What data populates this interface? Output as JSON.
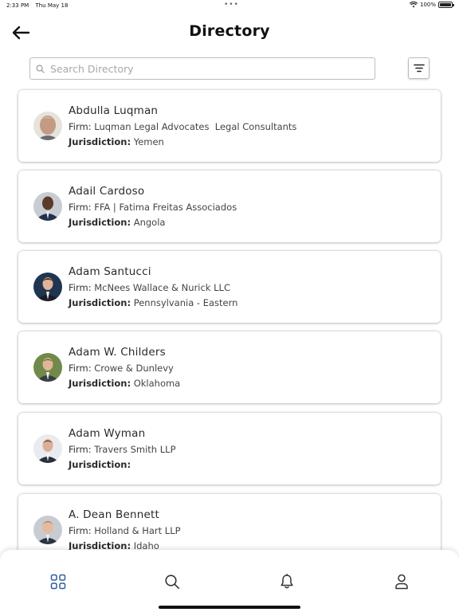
{
  "status_bar": {
    "time": "2:33 PM",
    "date": "Thu May 18",
    "battery": "100%"
  },
  "header": {
    "title": "Directory"
  },
  "search": {
    "placeholder": "Search Directory",
    "value": ""
  },
  "labels": {
    "firm": "Firm:",
    "jurisdiction": "Jurisdiction:"
  },
  "contacts": [
    {
      "name": "Abdulla Luqman",
      "firm": "Luqman Legal Advocates  Legal Consultants",
      "jurisdiction": "Yemen"
    },
    {
      "name": "Adail Cardoso",
      "firm": "FFA | Fatima Freitas Associados",
      "jurisdiction": "Angola"
    },
    {
      "name": "Adam Santucci",
      "firm": "McNees Wallace & Nurick LLC",
      "jurisdiction": "Pennsylvania - Eastern"
    },
    {
      "name": "Adam W. Childers",
      "firm": "Crowe & Dunlevy",
      "jurisdiction": "Oklahoma"
    },
    {
      "name": "Adam Wyman",
      "firm": "Travers Smith LLP",
      "jurisdiction": ""
    },
    {
      "name": "A. Dean Bennett",
      "firm": "Holland & Hart LLP",
      "jurisdiction": "Idaho"
    }
  ],
  "tabs": [
    {
      "name": "home",
      "icon": "grid-icon",
      "active": true
    },
    {
      "name": "search",
      "icon": "search-icon",
      "active": false
    },
    {
      "name": "notifications",
      "icon": "bell-icon",
      "active": false
    },
    {
      "name": "profile",
      "icon": "user-icon",
      "active": false
    }
  ],
  "colors": {
    "accent": "#2f5e9e",
    "tab_inactive": "#333333",
    "card_shadow": "#c8c8c8"
  }
}
